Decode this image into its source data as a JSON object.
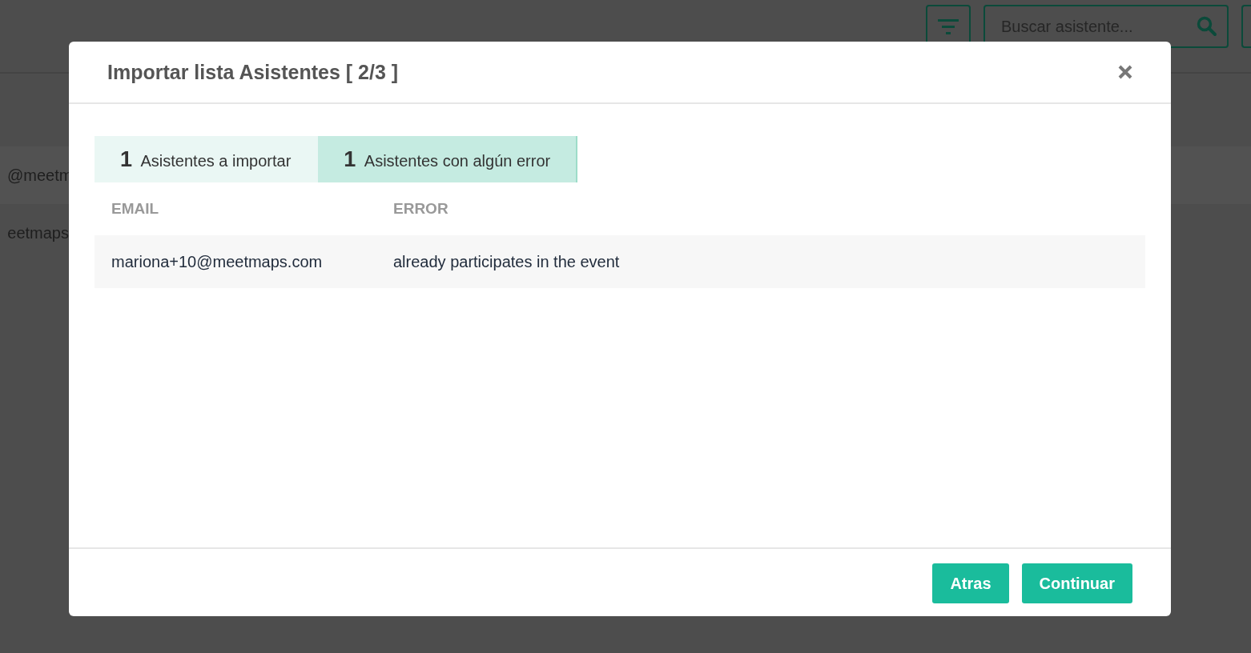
{
  "background": {
    "search": {
      "placeholder": "Buscar asistente..."
    },
    "rows": [
      {
        "text": "@meetm"
      },
      {
        "text": "eetmaps"
      }
    ]
  },
  "dialog": {
    "title": "Importar lista Asistentes [ 2/3 ]",
    "tabs": [
      {
        "count": "1",
        "label": "Asistentes a importar",
        "selected": false
      },
      {
        "count": "1",
        "label": "Asistentes con algún error",
        "selected": true
      }
    ],
    "columns": [
      "EMAIL",
      "ERROR"
    ],
    "rows": [
      {
        "email": "mariona+10@meetmaps.com",
        "error": "already participates in the event"
      }
    ],
    "buttons": [
      "Atras",
      "Continuar"
    ]
  }
}
